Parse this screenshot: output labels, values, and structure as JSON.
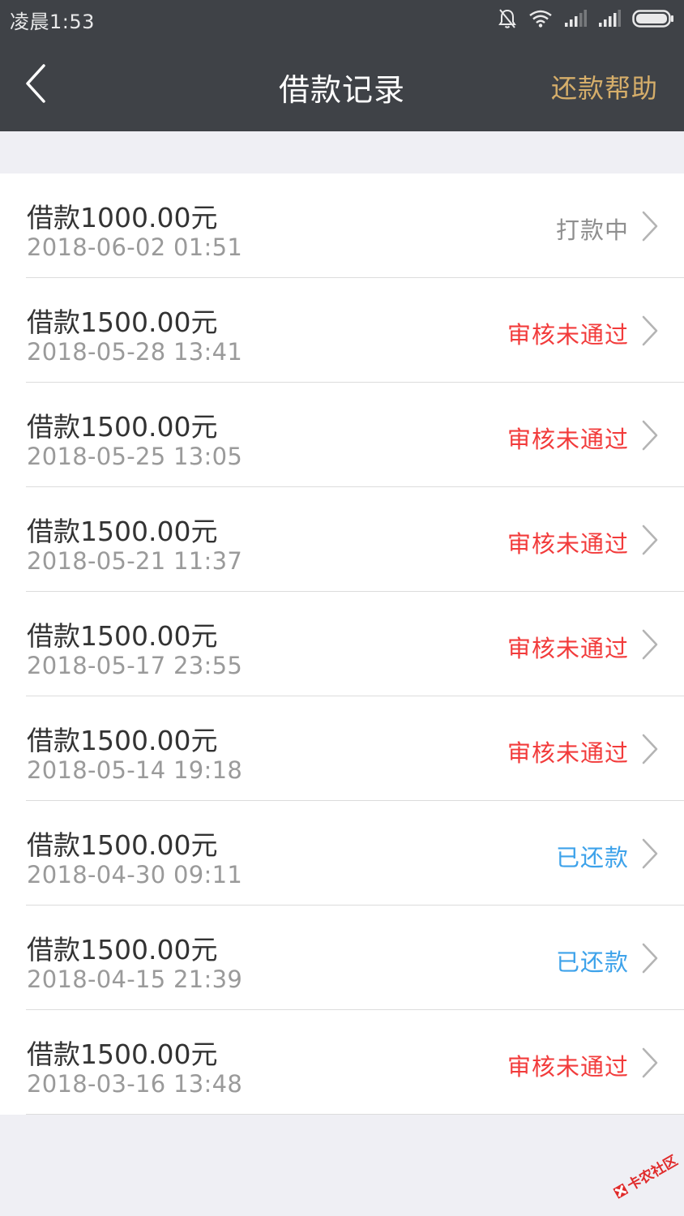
{
  "status_bar": {
    "time": "凌晨1:53",
    "icons": [
      "bell-muted-icon",
      "wifi-icon",
      "signal-icon",
      "signal-icon",
      "battery-icon"
    ]
  },
  "header": {
    "title": "借款记录",
    "help_label": "还款帮助",
    "back_icon": "chevron-left-icon"
  },
  "colors": {
    "header_bg": "#3f4247",
    "help_accent": "#d6ae6a",
    "status_processing": "#8f8f8f",
    "status_rejected": "#f23b3b",
    "status_repaid": "#3da2ea"
  },
  "records": [
    {
      "amount": "借款1000.00元",
      "date": "2018-06-02 01:51",
      "status": "打款中",
      "status_type": "processing"
    },
    {
      "amount": "借款1500.00元",
      "date": "2018-05-28 13:41",
      "status": "审核未通过",
      "status_type": "rejected"
    },
    {
      "amount": "借款1500.00元",
      "date": "2018-05-25 13:05",
      "status": "审核未通过",
      "status_type": "rejected"
    },
    {
      "amount": "借款1500.00元",
      "date": "2018-05-21 11:37",
      "status": "审核未通过",
      "status_type": "rejected"
    },
    {
      "amount": "借款1500.00元",
      "date": "2018-05-17 23:55",
      "status": "审核未通过",
      "status_type": "rejected"
    },
    {
      "amount": "借款1500.00元",
      "date": "2018-05-14 19:18",
      "status": "审核未通过",
      "status_type": "rejected"
    },
    {
      "amount": "借款1500.00元",
      "date": "2018-04-30 09:11",
      "status": "已还款",
      "status_type": "repaid"
    },
    {
      "amount": "借款1500.00元",
      "date": "2018-04-15 21:39",
      "status": "已还款",
      "status_type": "repaid"
    },
    {
      "amount": "借款1500.00元",
      "date": "2018-03-16 13:48",
      "status": "审核未通过",
      "status_type": "rejected"
    }
  ],
  "watermark": {
    "text": "卡农社区"
  }
}
